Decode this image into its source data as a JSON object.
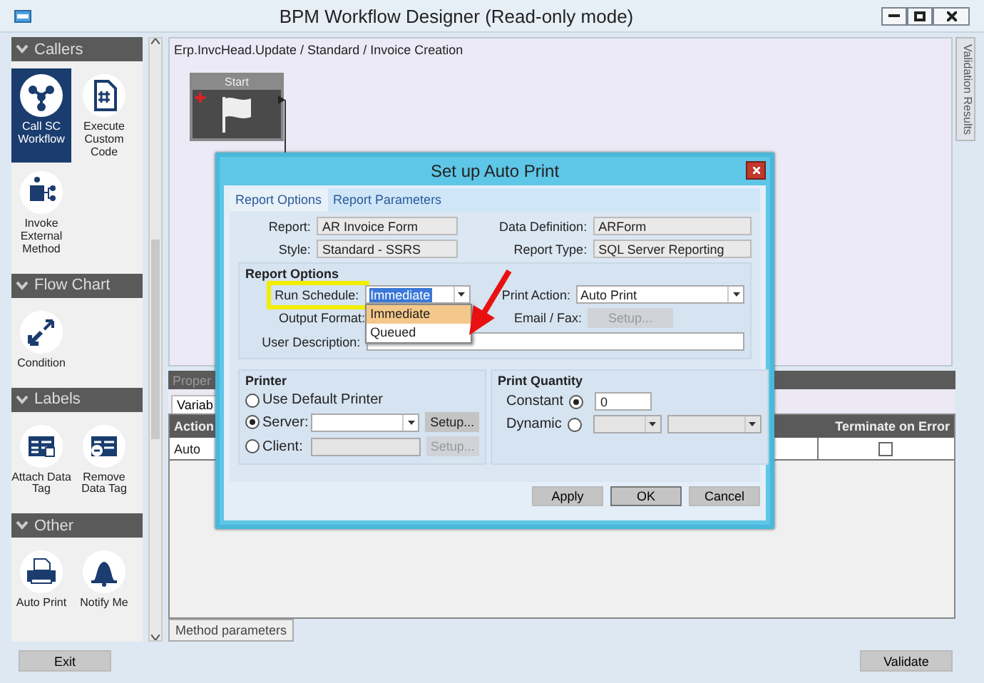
{
  "window": {
    "title": "BPM Workflow Designer (Read-only mode)"
  },
  "toolbox": [
    {
      "title": "Callers",
      "expanded": true,
      "items": [
        {
          "label": "Call SC Workflow",
          "selected": true
        },
        {
          "label": "Execute Custom Code",
          "selected": false
        },
        {
          "label": "Invoke External Method",
          "selected": false
        }
      ]
    },
    {
      "title": "Flow Chart",
      "expanded": true,
      "items": [
        {
          "label": "Condition",
          "selected": false
        }
      ]
    },
    {
      "title": "Labels",
      "expanded": true,
      "items": [
        {
          "label": "Attach Data Tag",
          "selected": false
        },
        {
          "label": "Remove Data Tag",
          "selected": false
        }
      ]
    },
    {
      "title": "Other",
      "expanded": true,
      "items": [
        {
          "label": "Auto Print",
          "selected": false
        },
        {
          "label": "Notify Me",
          "selected": false
        }
      ]
    }
  ],
  "canvas": {
    "breadcrumb": "Erp.InvcHead.Update / Standard / Invoice Creation",
    "nodes": [
      {
        "title": "Start"
      }
    ]
  },
  "validation_tab": "Validation Results",
  "properties": {
    "title": "Proper",
    "tabs": [
      {
        "label": "Variab",
        "selected": true
      }
    ],
    "table": {
      "columns": [
        "Action",
        "Terminate on Error"
      ],
      "rows": [
        {
          "action": "Auto",
          "terminate_on_error": false
        }
      ]
    },
    "bottom_tabs": [
      {
        "label": "Method parameters",
        "selected": true
      }
    ]
  },
  "footer": {
    "exit": "Exit",
    "validate": "Validate"
  },
  "dialog": {
    "title": "Set up Auto Print",
    "tabs": [
      {
        "label": "Report Options",
        "selected": true
      },
      {
        "label": "Report Parameters",
        "selected": false
      }
    ],
    "report": {
      "label": "Report:",
      "value": "AR Invoice Form"
    },
    "style": {
      "label": "Style:",
      "value": "Standard - SSRS"
    },
    "data_definition": {
      "label": "Data Definition:",
      "value": "ARForm"
    },
    "report_type": {
      "label": "Report Type:",
      "value": "SQL Server Reporting"
    },
    "report_options": {
      "title": "Report Options",
      "run_schedule": {
        "label": "Run Schedule:",
        "value": "Immediate",
        "expanded": true,
        "options": [
          {
            "label": "Immediate",
            "selected": true
          },
          {
            "label": "Queued",
            "selected": false
          }
        ]
      },
      "output_format": {
        "label": "Output Format:"
      },
      "print_action": {
        "label": "Print Action:",
        "value": "Auto Print"
      },
      "email_fax": {
        "label": "Email / Fax:",
        "button": "Setup...",
        "disabled": true
      },
      "user_description": {
        "label": "User Description:"
      }
    },
    "printer": {
      "title": "Printer",
      "options": [
        {
          "kind": "plain",
          "label": "Use Default Printer",
          "selected": false
        },
        {
          "kind": "combo",
          "label": "Server:",
          "selected": true,
          "button": "Setup...",
          "disabled": false
        },
        {
          "kind": "text",
          "label": "Client:",
          "selected": false,
          "button": "Setup...",
          "disabled": true
        }
      ]
    },
    "print_quantity": {
      "title": "Print Quantity",
      "options": [
        {
          "kind": "number",
          "label": "Constant",
          "selected": true,
          "value": "0"
        },
        {
          "kind": "combos",
          "label": "Dynamic",
          "selected": false
        }
      ]
    },
    "buttons": [
      "Apply",
      "OK",
      "Cancel"
    ]
  }
}
